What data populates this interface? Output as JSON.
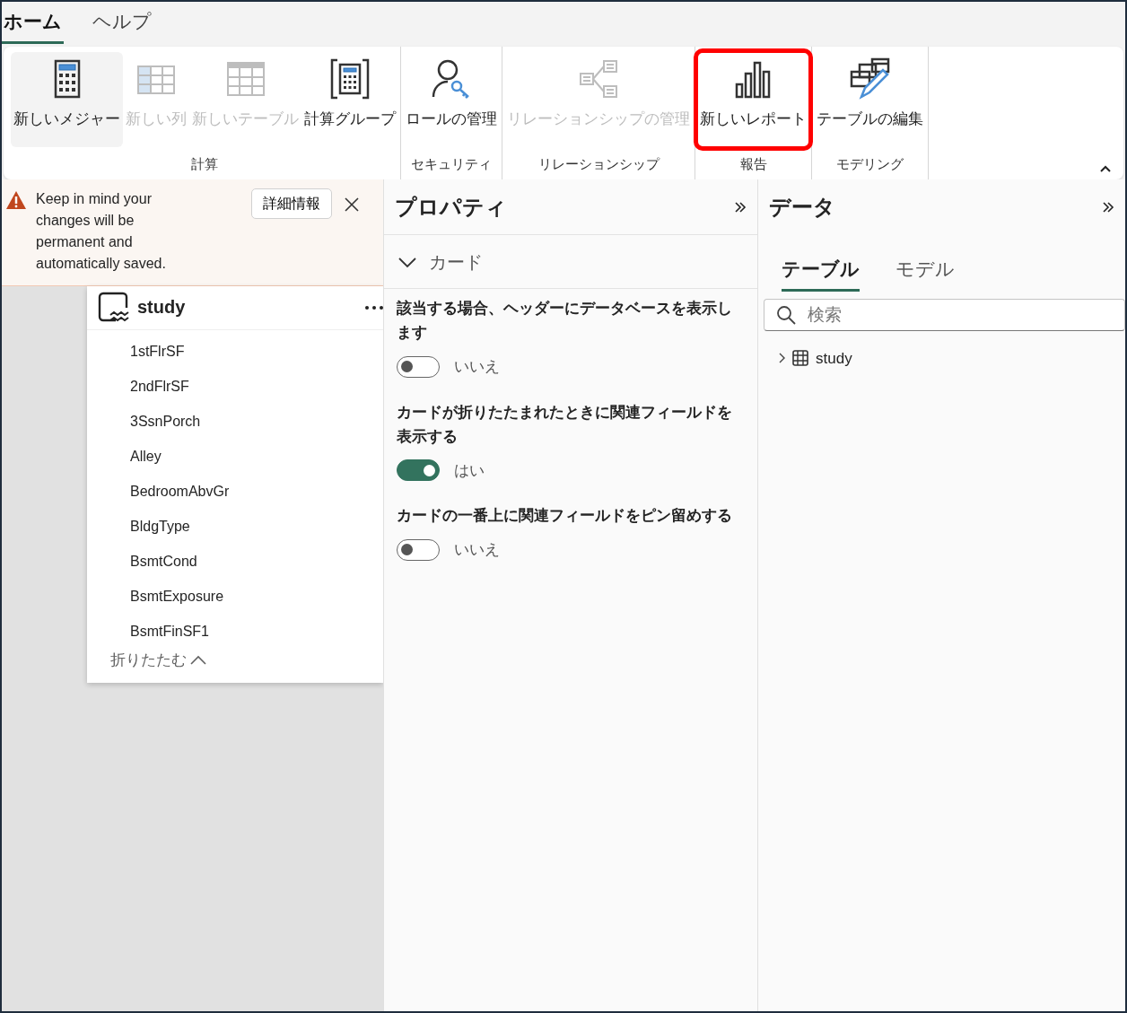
{
  "tabs": [
    {
      "label": "ホーム",
      "selected": true
    },
    {
      "label": "ヘルプ",
      "selected": false
    }
  ],
  "ribbon": {
    "groups": [
      {
        "label": "計算",
        "buttons": [
          {
            "label": "新しいメジャー",
            "kind": "calculator",
            "disabled": false,
            "selected": true,
            "highlighted": false
          },
          {
            "label": "新しい列",
            "kind": "column",
            "disabled": true,
            "selected": false,
            "highlighted": false
          },
          {
            "label": "新しいテーブル",
            "kind": "table",
            "disabled": true,
            "selected": false,
            "highlighted": false
          },
          {
            "label": "計算グループ",
            "kind": "calcgroup",
            "disabled": false,
            "selected": false,
            "highlighted": false
          }
        ]
      },
      {
        "label": "セキュリティ",
        "buttons": [
          {
            "label": "ロールの管理",
            "kind": "role",
            "disabled": false,
            "selected": false,
            "highlighted": false
          }
        ]
      },
      {
        "label": "リレーションシップ",
        "buttons": [
          {
            "label": "リレーションシップの管理",
            "kind": "relation",
            "disabled": true,
            "selected": false,
            "highlighted": false
          }
        ]
      },
      {
        "label": "報告",
        "buttons": [
          {
            "label": "新しいレポート",
            "kind": "report",
            "disabled": false,
            "selected": false,
            "highlighted": true
          }
        ]
      },
      {
        "label": "モデリング",
        "buttons": [
          {
            "label": "テーブルの編集",
            "kind": "edittable",
            "disabled": false,
            "selected": false,
            "highlighted": false
          }
        ]
      }
    ]
  },
  "warning": {
    "message": "Keep in mind your changes will be permanent and automatically saved.",
    "button": "詳細情報"
  },
  "table_card": {
    "title": "study",
    "fields": [
      "1stFlrSF",
      "2ndFlrSF",
      "3SsnPorch",
      "Alley",
      "BedroomAbvGr",
      "BldgType",
      "BsmtCond",
      "BsmtExposure",
      "BsmtFinSF1"
    ],
    "collapse_label": "折りたたむ"
  },
  "properties": {
    "title": "プロパティ",
    "section": {
      "label": "カード",
      "expanded": true
    },
    "settings": [
      {
        "label": "該当する場合、ヘッダーにデータベースを表示します",
        "on": false,
        "value": "いいえ"
      },
      {
        "label": "カードが折りたたまれたときに関連フィールドを表示する",
        "on": true,
        "value": "はい"
      },
      {
        "label": "カードの一番上に関連フィールドをピン留めする",
        "on": false,
        "value": "いいえ"
      }
    ]
  },
  "data": {
    "title": "データ",
    "tabs": [
      {
        "label": "テーブル",
        "selected": true
      },
      {
        "label": "モデル",
        "selected": false
      }
    ],
    "search": {
      "placeholder": "検索"
    },
    "tree": [
      {
        "label": "study",
        "expanded": false
      }
    ]
  }
}
